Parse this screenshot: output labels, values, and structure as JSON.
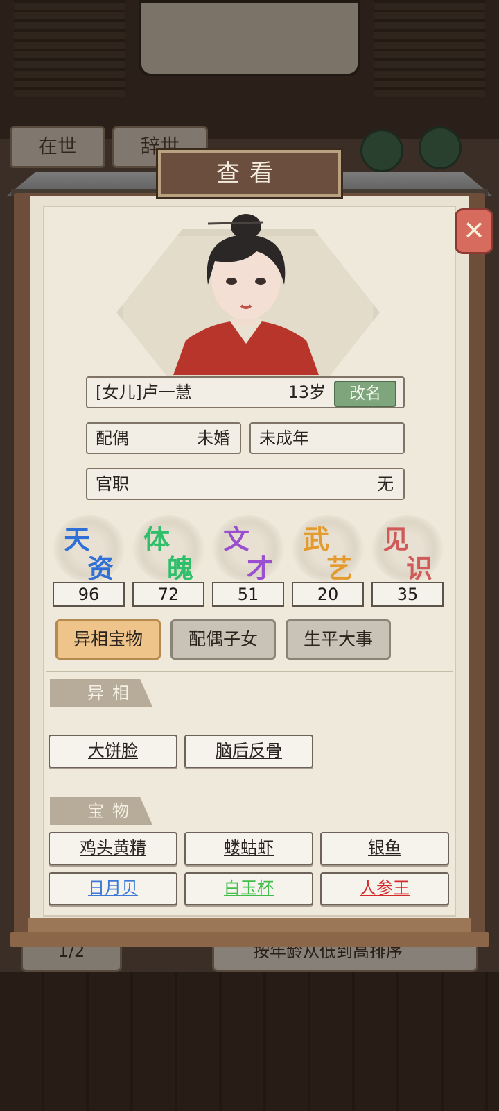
{
  "background": {
    "tabs": [
      "在世",
      "辞世"
    ],
    "pager": "1/2",
    "sort_label": "按年龄从低到高排序"
  },
  "modal": {
    "title": "查看",
    "close_icon": "close-x-icon"
  },
  "person": {
    "name": "[女儿]卢一慧",
    "age": "13岁",
    "rename_label": "改名",
    "spouse_label": "配偶",
    "spouse_value": "未婚",
    "status": "未成年",
    "office_label": "官职",
    "office_value": "无"
  },
  "stats": [
    {
      "label": "天资",
      "value": "96",
      "color": "#2f6fd6"
    },
    {
      "label": "体魄",
      "value": "72",
      "color": "#2fbf6a"
    },
    {
      "label": "文才",
      "value": "51",
      "color": "#9a4fd1"
    },
    {
      "label": "武艺",
      "value": "20",
      "color": "#e39a2e"
    },
    {
      "label": "见识",
      "value": "35",
      "color": "#d05a5a"
    }
  ],
  "tabs": [
    {
      "label": "异相宝物",
      "active": true
    },
    {
      "label": "配偶子女",
      "active": false
    },
    {
      "label": "生平大事",
      "active": false
    }
  ],
  "traits": {
    "title": "异相",
    "items": [
      "大饼脸",
      "脑后反骨"
    ]
  },
  "treasures": {
    "title": "宝物",
    "items": [
      {
        "label": "鸡头黄精",
        "color": "#2a2420"
      },
      {
        "label": "蝼蛄虾",
        "color": "#2a2420"
      },
      {
        "label": "银鱼",
        "color": "#2a2420"
      },
      {
        "label": "日月贝",
        "color": "#3b78d8"
      },
      {
        "label": "白玉杯",
        "color": "#3fbf4a"
      },
      {
        "label": "人参王",
        "color": "#d42a2a"
      }
    ]
  }
}
